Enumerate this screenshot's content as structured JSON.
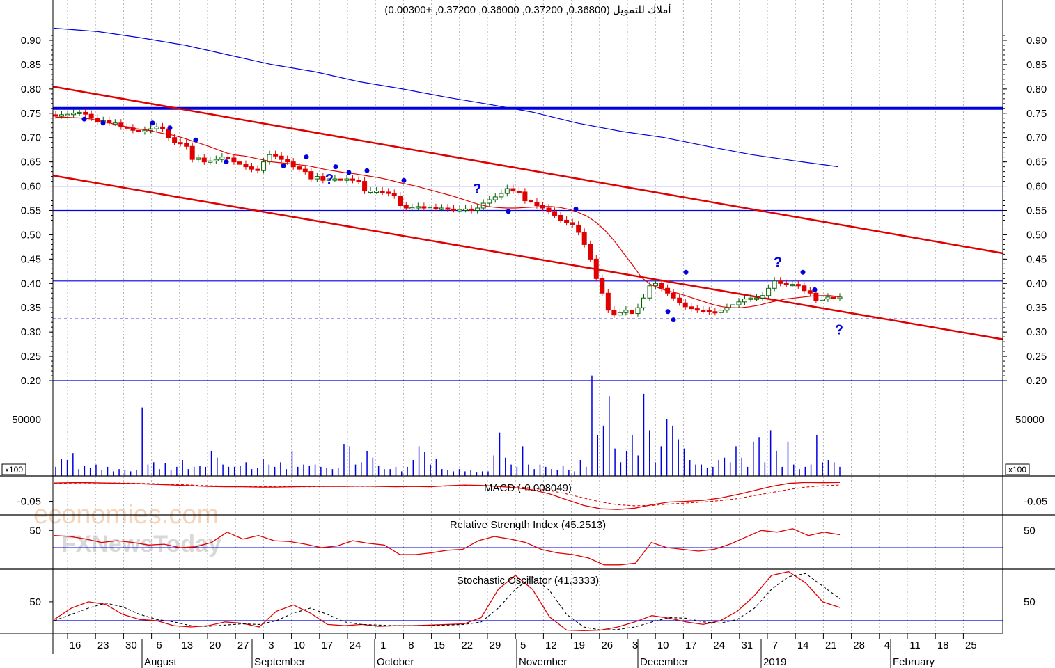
{
  "header": {
    "title": "أملاك للتمويل (0.36800, 0.37200, 0.36000, 0.37200, +0.00300)"
  },
  "watermark": {
    "line1": "economies.com",
    "line2": "FXNewsToday"
  },
  "colors": {
    "up": "#006400",
    "down": "#e00000",
    "ma": "#e00000",
    "long_ma": "#0000e0",
    "hline": "#0000e0",
    "channel": "#e00000",
    "marker": "#0000e0"
  },
  "chart_data": [
    {
      "type": "candlestick",
      "title": "أملاك للتمويل (0.36800, 0.37200, 0.36000, 0.37200, +0.00300)",
      "ylim": [
        0.18,
        0.94
      ],
      "y_ticks": [
        "0.90",
        "0.85",
        "0.80",
        "0.75",
        "0.70",
        "0.65",
        "0.60",
        "0.55",
        "0.50",
        "0.45",
        "0.40",
        "0.35",
        "0.30",
        "0.25",
        "0.20"
      ],
      "x_ticks": [
        "16",
        "23",
        "30",
        "6",
        "13",
        "20",
        "27",
        "3",
        "10",
        "17",
        "24",
        "1",
        "8",
        "15",
        "22",
        "29",
        "5",
        "12",
        "19",
        "26",
        "3",
        "10",
        "17",
        "24",
        "31",
        "7",
        "14",
        "21",
        "28",
        "4",
        "11",
        "18",
        "25"
      ],
      "month_labels": [
        "August",
        "September",
        "October",
        "November",
        "December",
        "2019",
        "February"
      ],
      "close_series": [
        0.745,
        0.747,
        0.748,
        0.75,
        0.752,
        0.748,
        0.74,
        0.732,
        0.735,
        0.73,
        0.73,
        0.722,
        0.72,
        0.715,
        0.712,
        0.715,
        0.718,
        0.722,
        0.718,
        0.7,
        0.69,
        0.688,
        0.682,
        0.655,
        0.658,
        0.65,
        0.652,
        0.655,
        0.66,
        0.658,
        0.65,
        0.645,
        0.64,
        0.635,
        0.632,
        0.65,
        0.665,
        0.662,
        0.655,
        0.65,
        0.64,
        0.635,
        0.63,
        0.615,
        0.62,
        0.612,
        0.615,
        0.615,
        0.612,
        0.615,
        0.612,
        0.61,
        0.59,
        0.59,
        0.59,
        0.588,
        0.585,
        0.58,
        0.56,
        0.555,
        0.556,
        0.558,
        0.555,
        0.556,
        0.555,
        0.555,
        0.553,
        0.552,
        0.552,
        0.553,
        0.55,
        0.555,
        0.565,
        0.572,
        0.578,
        0.585,
        0.595,
        0.59,
        0.588,
        0.57,
        0.567,
        0.56,
        0.555,
        0.548,
        0.54,
        0.53,
        0.525,
        0.52,
        0.505,
        0.48,
        0.45,
        0.41,
        0.38,
        0.345,
        0.335,
        0.34,
        0.345,
        0.338,
        0.35,
        0.37,
        0.395,
        0.4,
        0.39,
        0.38,
        0.37,
        0.36,
        0.352,
        0.348,
        0.345,
        0.344,
        0.342,
        0.34,
        0.345,
        0.35,
        0.356,
        0.362,
        0.368,
        0.37,
        0.37,
        0.375,
        0.39,
        0.405,
        0.4,
        0.398,
        0.398,
        0.395,
        0.385,
        0.38,
        0.365,
        0.368,
        0.372,
        0.37,
        0.372
      ],
      "ma_series": [
        0.742,
        0.742,
        0.741,
        0.74,
        0.738,
        0.734,
        0.73,
        0.725,
        0.722,
        0.718,
        0.716,
        0.712,
        0.708,
        0.705,
        0.7,
        0.694,
        0.688,
        0.682,
        0.675,
        0.668,
        0.664,
        0.662,
        0.658,
        0.654,
        0.65,
        0.648,
        0.646,
        0.644,
        0.642,
        0.638,
        0.634,
        0.631,
        0.628,
        0.626,
        0.623,
        0.62,
        0.617,
        0.613,
        0.608,
        0.604,
        0.6,
        0.595,
        0.59,
        0.585,
        0.58,
        0.574,
        0.568,
        0.562,
        0.558,
        0.556,
        0.555,
        0.555,
        0.556,
        0.557,
        0.558,
        0.558,
        0.556,
        0.552,
        0.546,
        0.538,
        0.525,
        0.508,
        0.487,
        0.462,
        0.438,
        0.412,
        0.398,
        0.39,
        0.384,
        0.38,
        0.374,
        0.368,
        0.362,
        0.356,
        0.352,
        0.35,
        0.35,
        0.352,
        0.355,
        0.36,
        0.364,
        0.368,
        0.37,
        0.372,
        0.374,
        0.375,
        0.375,
        0.372
      ],
      "long_ma_series": [
        0.925,
        0.918,
        0.905,
        0.89,
        0.87,
        0.85,
        0.835,
        0.815,
        0.8,
        0.783,
        0.768,
        0.752,
        0.73,
        0.713,
        0.7,
        0.682,
        0.665,
        0.652,
        0.64
      ],
      "horizontal_lines": [
        0.76,
        0.6,
        0.55,
        0.405,
        0.327,
        0.2
      ],
      "channel": {
        "upper": [
          0.805,
          0.462
        ],
        "lower": [
          0.622,
          0.285
        ]
      },
      "volume_ticks": [
        "50000"
      ],
      "volume_unit": "x100",
      "volume_series": [
        8,
        15,
        14,
        20,
        6,
        9,
        7,
        10,
        5,
        8,
        4,
        6,
        5,
        4,
        5,
        60,
        10,
        12,
        6,
        11,
        5,
        8,
        14,
        6,
        8,
        9,
        8,
        22,
        16,
        10,
        8,
        8,
        9,
        12,
        6,
        7,
        15,
        10,
        8,
        12,
        6,
        22,
        8,
        10,
        9,
        10,
        8,
        7,
        6,
        7,
        28,
        26,
        10,
        12,
        22,
        16,
        9,
        6,
        6,
        8,
        4,
        8,
        14,
        26,
        21,
        10,
        15,
        6,
        5,
        4,
        6,
        4,
        5,
        3,
        4,
        4,
        18,
        38,
        16,
        10,
        8,
        26,
        10,
        6,
        10,
        8,
        6,
        5,
        9,
        5,
        4,
        14,
        8,
        88,
        36,
        44,
        70,
        24,
        12,
        22,
        36,
        18,
        72,
        40,
        12,
        26,
        50,
        44,
        32,
        24,
        14,
        10,
        10,
        7,
        8,
        14,
        16,
        12,
        26,
        16,
        8,
        30,
        34,
        12,
        40,
        22,
        8,
        30,
        10,
        6,
        8,
        10,
        36,
        12,
        14,
        12,
        8
      ]
    },
    {
      "type": "line",
      "title": "MACD (-0.008049)",
      "ylim": [
        -0.09,
        0.025
      ],
      "y_ticks": [
        "-0.05"
      ],
      "series": [
        {
          "name": "MACD",
          "values": [
            0.004,
            0.005,
            0.005,
            0.004,
            0.003,
            0.002,
            0.0,
            -0.002,
            -0.004,
            -0.006,
            -0.007,
            -0.007,
            -0.008,
            -0.008,
            -0.007,
            -0.006,
            -0.006,
            -0.006,
            -0.005,
            -0.006,
            -0.007,
            -0.006,
            -0.007,
            -0.004,
            -0.002,
            -0.003,
            -0.006,
            -0.01,
            -0.016,
            -0.028,
            -0.045,
            -0.062,
            -0.072,
            -0.074,
            -0.07,
            -0.06,
            -0.052,
            -0.05,
            -0.047,
            -0.04,
            -0.03,
            -0.018,
            -0.006,
            0.003,
            0.006,
            0.005,
            0.006
          ]
        },
        {
          "name": "Signal",
          "values": [
            0.003,
            0.004,
            0.004,
            0.004,
            0.004,
            0.003,
            0.002,
            0.0,
            -0.002,
            -0.004,
            -0.005,
            -0.006,
            -0.007,
            -0.007,
            -0.007,
            -0.007,
            -0.006,
            -0.006,
            -0.006,
            -0.006,
            -0.006,
            -0.006,
            -0.006,
            -0.005,
            -0.004,
            -0.004,
            -0.005,
            -0.007,
            -0.011,
            -0.018,
            -0.028,
            -0.04,
            -0.052,
            -0.06,
            -0.063,
            -0.062,
            -0.058,
            -0.055,
            -0.052,
            -0.048,
            -0.042,
            -0.033,
            -0.024,
            -0.015,
            -0.008,
            -0.004,
            -0.002
          ]
        }
      ]
    },
    {
      "type": "line",
      "title": "Relative Strength Index (45.2513)",
      "ylim": [
        5,
        68
      ],
      "y_ticks": [
        "50"
      ],
      "reference_line": 30,
      "series": [
        {
          "name": "RSI",
          "values": [
            44,
            43,
            40,
            36,
            38,
            36,
            33,
            34,
            30,
            31,
            36,
            48,
            40,
            44,
            38,
            37,
            34,
            30,
            32,
            38,
            35,
            33,
            22,
            22,
            24,
            27,
            28,
            38,
            43,
            40,
            36,
            28,
            24,
            22,
            18,
            10,
            10,
            12,
            36,
            30,
            28,
            26,
            28,
            34,
            42,
            50,
            48,
            52,
            44,
            48,
            45
          ]
        }
      ]
    },
    {
      "type": "line",
      "title": "Stochastic Oscillator (41.3333)",
      "ylim": [
        0,
        102
      ],
      "y_ticks": [
        "50"
      ],
      "reference_line": 20,
      "series": [
        {
          "name": "%K",
          "values": [
            22,
            40,
            50,
            46,
            30,
            22,
            20,
            12,
            10,
            12,
            18,
            16,
            10,
            35,
            45,
            32,
            14,
            12,
            14,
            11,
            12,
            12,
            13,
            14,
            15,
            25,
            70,
            92,
            70,
            26,
            5,
            4,
            5,
            10,
            18,
            28,
            24,
            18,
            14,
            20,
            35,
            60,
            92,
            98,
            80,
            50,
            41
          ]
        },
        {
          "name": "%D",
          "values": [
            20,
            30,
            40,
            48,
            42,
            30,
            22,
            18,
            12,
            11,
            13,
            15,
            14,
            20,
            32,
            40,
            30,
            18,
            14,
            13,
            12,
            12,
            12,
            13,
            14,
            18,
            40,
            70,
            90,
            68,
            30,
            10,
            5,
            6,
            10,
            18,
            25,
            24,
            18,
            16,
            22,
            40,
            70,
            90,
            95,
            75,
            55
          ]
        }
      ]
    }
  ]
}
